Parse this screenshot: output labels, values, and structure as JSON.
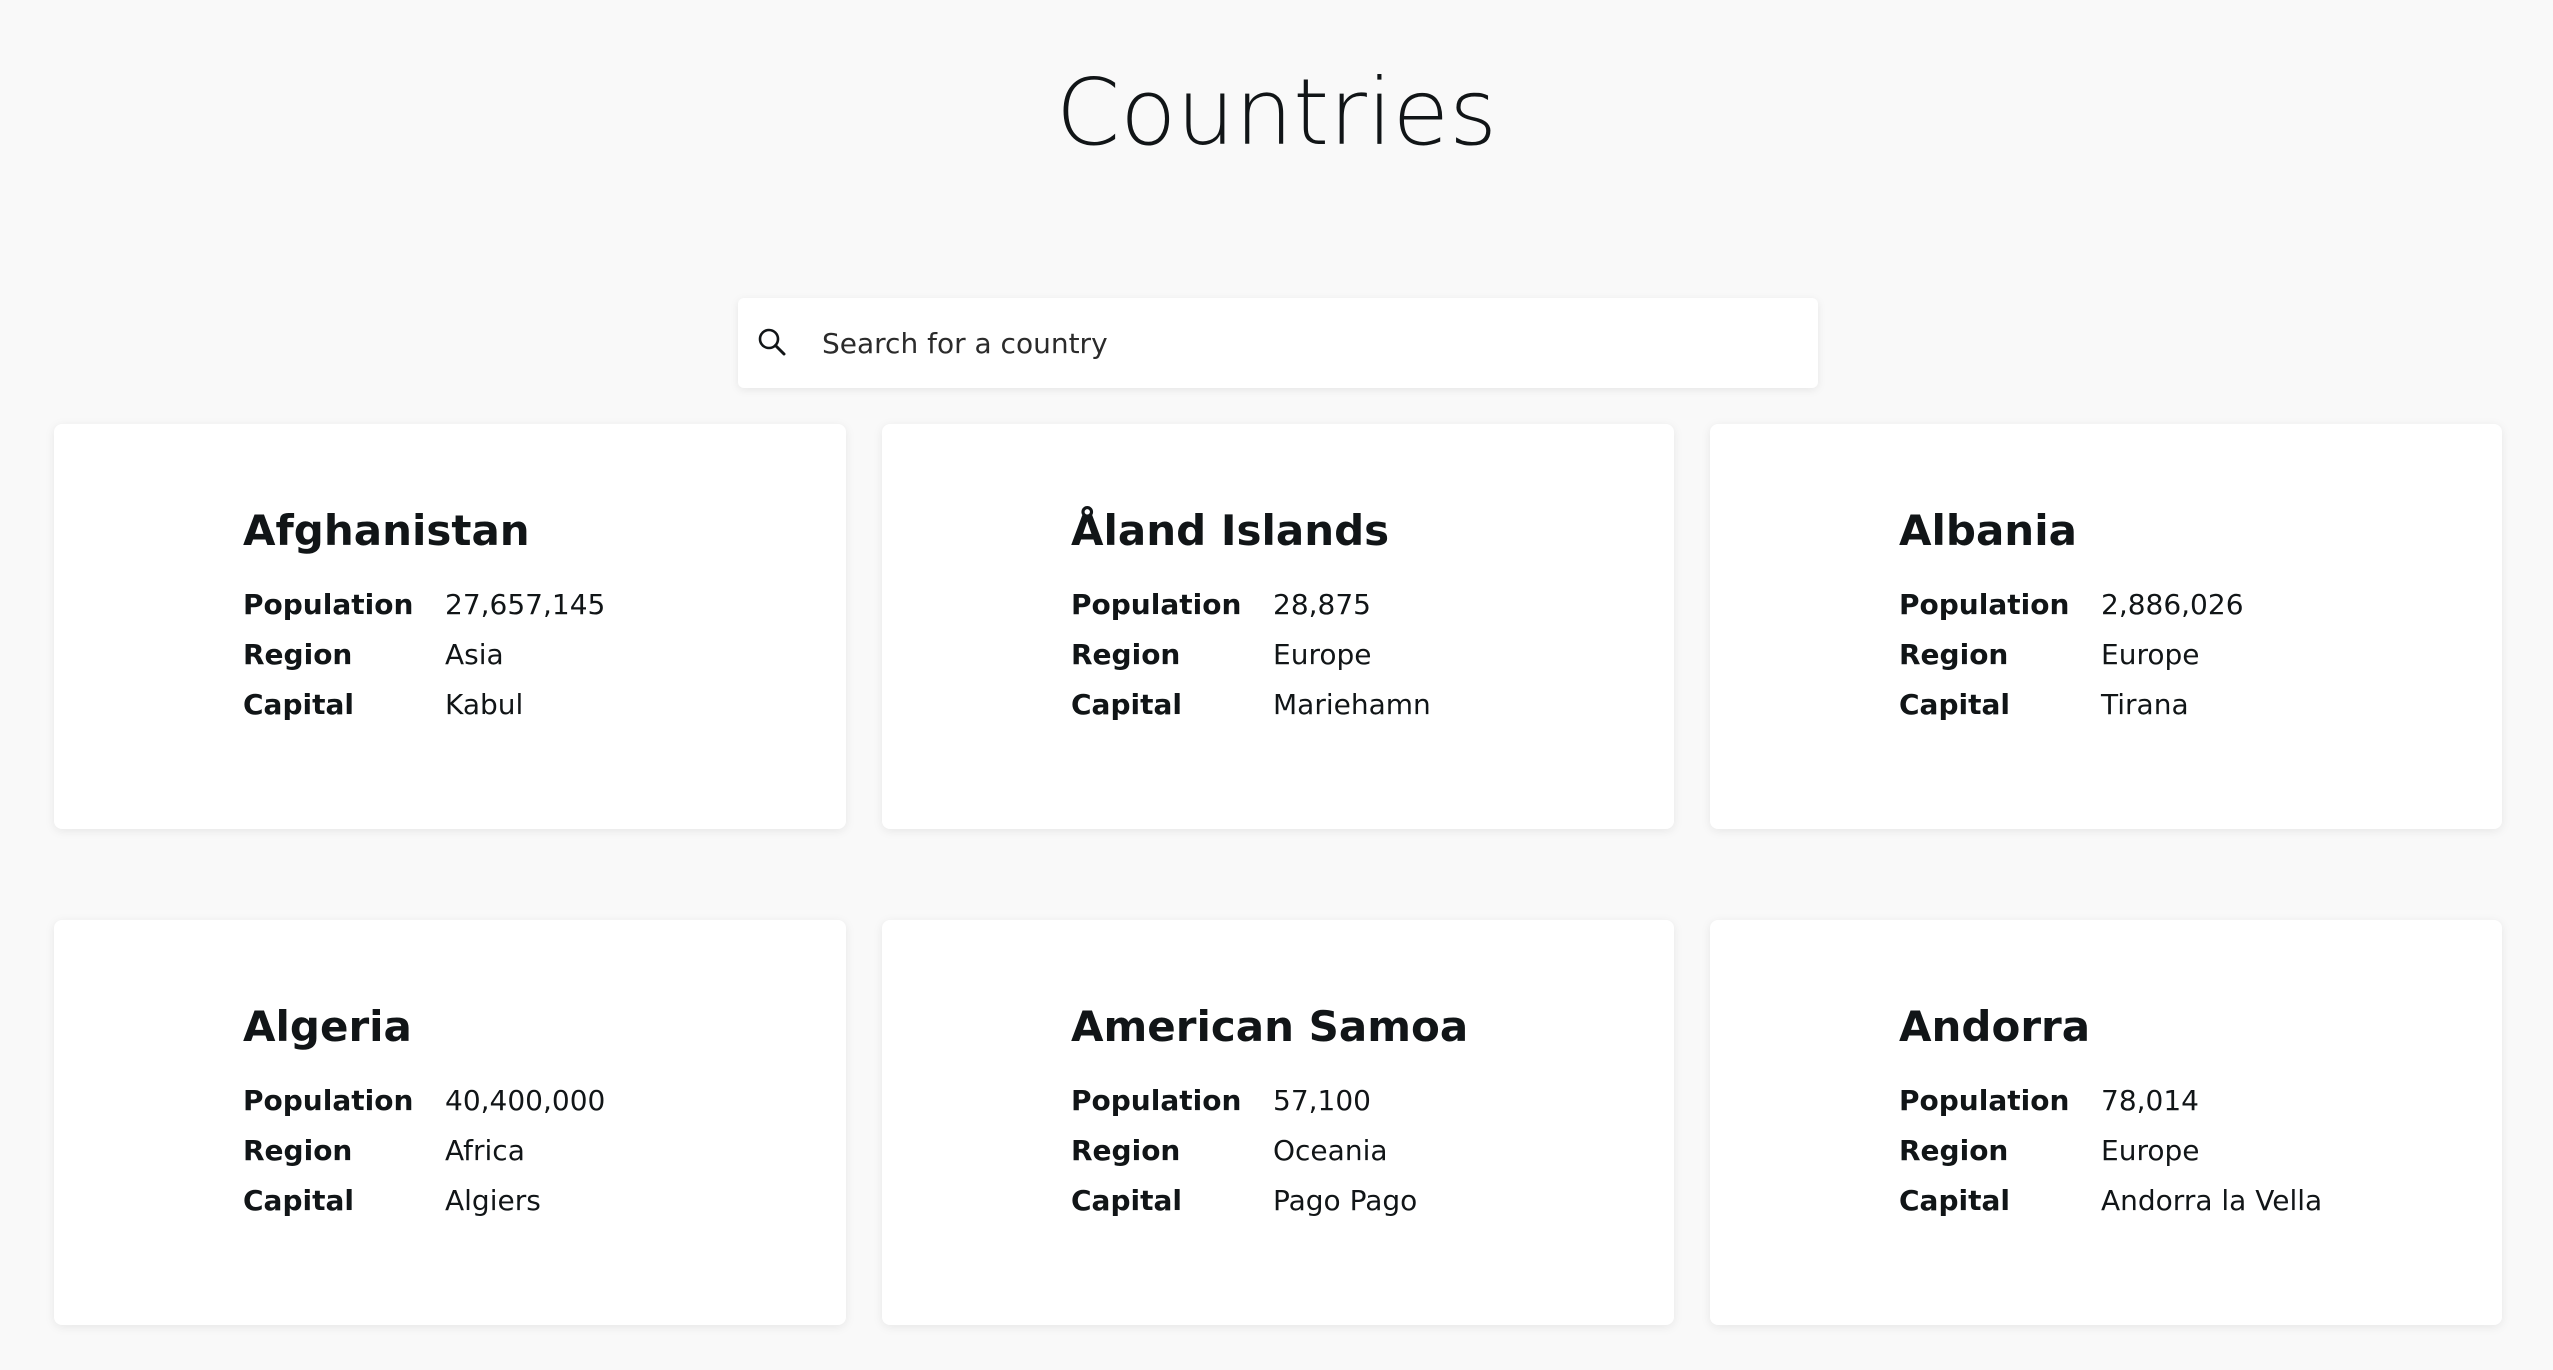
{
  "page": {
    "title": "Countries"
  },
  "search": {
    "placeholder": "Search for a country",
    "value": "",
    "icon": "search-icon"
  },
  "labels": {
    "population": "Population",
    "region": "Region",
    "capital": "Capital"
  },
  "countries": [
    {
      "name": "Afghanistan",
      "population": "27,657,145",
      "region": "Asia",
      "capital": "Kabul"
    },
    {
      "name": "Åland Islands",
      "population": "28,875",
      "region": "Europe",
      "capital": "Mariehamn"
    },
    {
      "name": "Albania",
      "population": "2,886,026",
      "region": "Europe",
      "capital": "Tirana"
    },
    {
      "name": "Algeria",
      "population": "40,400,000",
      "region": "Africa",
      "capital": "Algiers"
    },
    {
      "name": "American Samoa",
      "population": "57,100",
      "region": "Oceania",
      "capital": "Pago Pago"
    },
    {
      "name": "Andorra",
      "population": "78,014",
      "region": "Europe",
      "capital": "Andorra la Vella"
    }
  ],
  "colors": {
    "background": "#f9f9f9",
    "card": "#ffffff",
    "text": "#111517"
  }
}
